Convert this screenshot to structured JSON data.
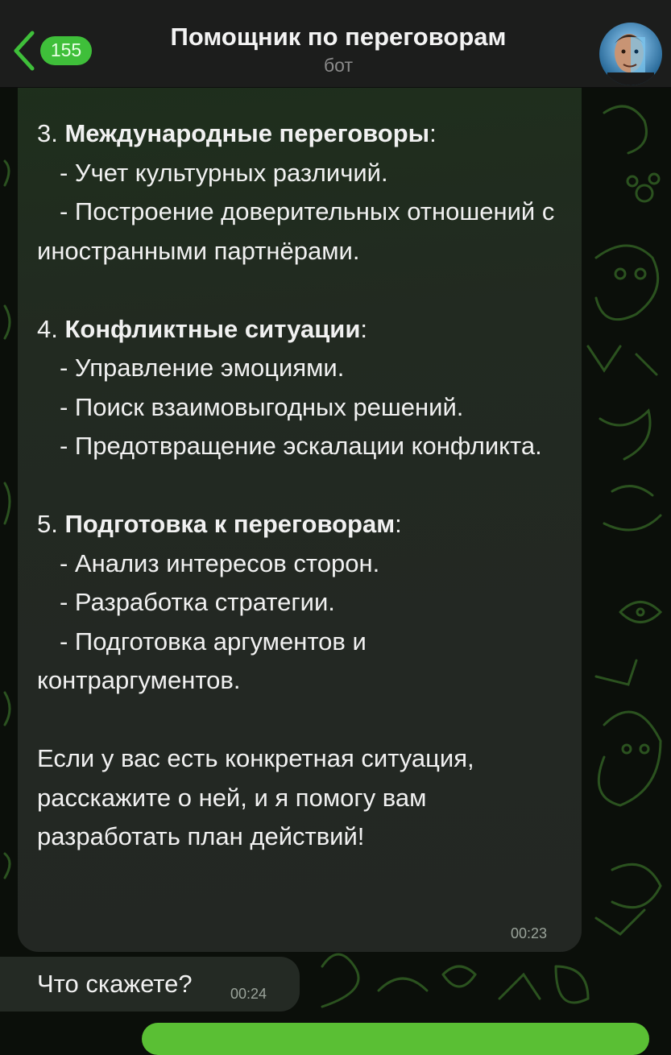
{
  "header": {
    "unread_count": "155",
    "title": "Помощник по переговорам",
    "subtitle": "бот"
  },
  "message_main": {
    "sections": [
      {
        "number": "3.",
        "heading": "Международные переговоры",
        "items": [
          "- Учет культурных различий.",
          "- Построение доверительных отношений с иностранными партнёрами."
        ]
      },
      {
        "number": "4.",
        "heading": "Конфликтные ситуации",
        "items": [
          "- Управление эмоциями.",
          "- Поиск взаимовыгодных решений.",
          "- Предотвращение эскалации конфликта."
        ]
      },
      {
        "number": "5.",
        "heading": "Подготовка к переговорам",
        "items": [
          "- Анализ интересов сторон.",
          "- Разработка стратегии.",
          "- Подготовка аргументов и контраргументов."
        ]
      }
    ],
    "closing": "Если у вас есть конкретная ситуация, расскажите о ней, и я помогу вам разработать план действий!",
    "time": "00:23"
  },
  "message_followup": {
    "text": "Что скажете?",
    "time": "00:24"
  },
  "colors": {
    "accent": "#3fbf3a",
    "bubble": "#232723",
    "header": "#1c1d1c"
  }
}
